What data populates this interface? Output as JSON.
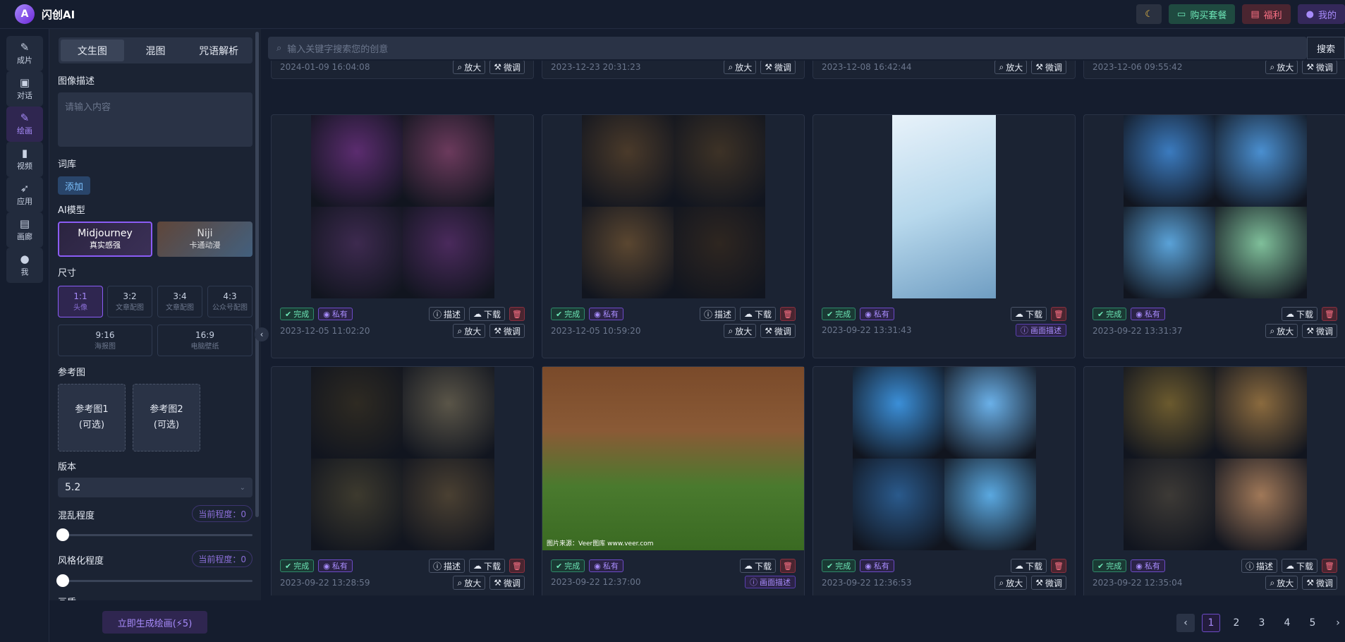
{
  "app": {
    "title": "闪创AI",
    "logo_letter": "A"
  },
  "topbar": {
    "buy": "购买套餐",
    "welfare": "福利",
    "mine": "我的"
  },
  "nav": [
    {
      "label": "成片",
      "icon": "✎",
      "name": "nav-chengpian"
    },
    {
      "label": "对话",
      "icon": "▣",
      "name": "nav-duihua"
    },
    {
      "label": "绘画",
      "icon": "✎",
      "name": "nav-huihua",
      "active": true
    },
    {
      "label": "视频",
      "icon": "▮",
      "name": "nav-shipin"
    },
    {
      "label": "应用",
      "icon": "➶",
      "name": "nav-yingyong"
    },
    {
      "label": "画廊",
      "icon": "▤",
      "name": "nav-hualang"
    },
    {
      "label": "我",
      "icon": "●",
      "name": "nav-wo"
    }
  ],
  "panel": {
    "tabs": [
      "文生图",
      "混图",
      "咒语解析"
    ],
    "desc_label": "图像描述",
    "desc_placeholder": "请输入内容",
    "lexicon_label": "词库",
    "add": "添加",
    "model_label": "AI模型",
    "models": [
      {
        "name": "Midjourney",
        "sub": "真实感强"
      },
      {
        "name": "Niji",
        "sub": "卡通动漫"
      }
    ],
    "size_label": "尺寸",
    "sizes": [
      {
        "r": "1:1",
        "d": "头像"
      },
      {
        "r": "3:2",
        "d": "文章配图"
      },
      {
        "r": "3:4",
        "d": "文章配图"
      },
      {
        "r": "4:3",
        "d": "公众号配图"
      },
      {
        "r": "9:16",
        "d": "海报图"
      },
      {
        "r": "16:9",
        "d": "电脑壁纸"
      }
    ],
    "ref_label": "参考图",
    "refs": [
      {
        "a": "参考图1",
        "b": "(可选)"
      },
      {
        "a": "参考图2",
        "b": "(可选)"
      }
    ],
    "version_label": "版本",
    "version": "5.2",
    "chaos_label": "混乱程度",
    "chaos_chip": "当前程度：0",
    "chaos_value": 0,
    "stylize_label": "风格化程度",
    "stylize_chip": "当前程度：0",
    "stylize_value": 0,
    "quality_label": "画质",
    "generate": "立即生成绘画(⚡5)"
  },
  "search": {
    "placeholder": "输入关键字搜索您的创意",
    "button": "搜索"
  },
  "actions": {
    "zoom": "放大",
    "tweak": "微调",
    "describe": "描述",
    "download": "下载",
    "done": "完成",
    "private": "私有",
    "paint_desc": "画面描述"
  },
  "top_dates": [
    "2024-01-09 16:04:08",
    "2023-12-23 20:31:23",
    "2023-12-08 16:42:44",
    "2023-12-06 09:55:42"
  ],
  "cards": [
    {
      "date": "2023-12-05 11:02:20",
      "kind": "grid",
      "colors": [
        "#5b2c6f",
        "#6b3a5c",
        "#3d2a4f",
        "#4a2a5c"
      ],
      "desc": true,
      "zoom": true
    },
    {
      "date": "2023-12-05 10:59:20",
      "kind": "grid",
      "colors": [
        "#4a3a2a",
        "#3d3226",
        "#5a4630",
        "#2e2620"
      ],
      "desc": true,
      "zoom": true
    },
    {
      "date": "2023-09-22 13:31:43",
      "kind": "single",
      "colors": [
        "#b7d8ec"
      ],
      "desc": false,
      "zoom": false,
      "paint": true
    },
    {
      "date": "2023-09-22 13:31:37",
      "kind": "grid",
      "colors": [
        "#3b7bbf",
        "#4a8fd0",
        "#5aa2d8",
        "#7fbf9a"
      ],
      "desc": false,
      "zoom": true
    },
    {
      "date": "2023-09-22 13:28:59",
      "kind": "grid",
      "colors": [
        "#2e2a22",
        "#5a5548",
        "#3d3a2e",
        "#4a4032"
      ],
      "desc": true,
      "zoom": true
    },
    {
      "date": "2023-09-22 12:37:00",
      "kind": "wide",
      "colors": [
        "#4a7a2e"
      ],
      "desc": false,
      "zoom": false,
      "paint": true
    },
    {
      "date": "2023-09-22 12:36:53",
      "kind": "grid",
      "colors": [
        "#3b8fd8",
        "#6ab0e8",
        "#2a5a8c",
        "#5aa8e0"
      ],
      "desc": false,
      "zoom": true
    },
    {
      "date": "2023-09-22 12:35:04",
      "kind": "grid",
      "colors": [
        "#6b5a2e",
        "#8a6a3e",
        "#3d3a36",
        "#a07858"
      ],
      "desc": true,
      "zoom": true
    }
  ],
  "watermark": "图片来源：Veer图库 www.veer.com",
  "pager": {
    "pages": [
      "1",
      "2",
      "3",
      "4",
      "5"
    ],
    "current": "1"
  }
}
